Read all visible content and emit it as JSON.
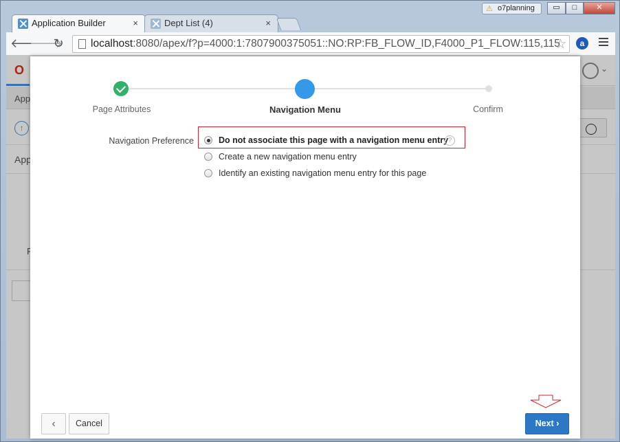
{
  "browser": {
    "tabs": [
      {
        "title": "Application Builder",
        "close": "×"
      },
      {
        "title": "Dept List (4)",
        "close": "×"
      }
    ],
    "user_badge": "o7planning",
    "window_buttons": {
      "minimize": "▭",
      "maximize": "□",
      "close": "✕"
    },
    "url_host": "localhost",
    "url_rest": ":8080/apex/f?p=4000:1:7807900375051::NO:RP:FB_FLOW_ID,F4000_P1_FLOW:115,115",
    "extension_letter": "a"
  },
  "background_page": {
    "text_app": "App",
    "text_app2": "App",
    "text_r": "R"
  },
  "wizard": {
    "steps": [
      {
        "label": "Page Attributes",
        "state": "done"
      },
      {
        "label": "Navigation Menu",
        "state": "current"
      },
      {
        "label": "Confirm",
        "state": "future"
      }
    ],
    "field_label": "Navigation Preference",
    "options": [
      {
        "label": "Do not associate this page with a navigation menu entry",
        "selected": true
      },
      {
        "label": "Create a new navigation menu entry",
        "selected": false
      },
      {
        "label": "Identify an existing navigation menu entry for this page",
        "selected": false
      }
    ],
    "help_glyph": "?",
    "buttons": {
      "back": "‹",
      "cancel": "Cancel",
      "next": "Next ›"
    }
  },
  "colors": {
    "step_done": "#2fb36b",
    "step_current": "#3598e8",
    "next_button": "#2c78c6",
    "highlight": "#c9262c"
  }
}
